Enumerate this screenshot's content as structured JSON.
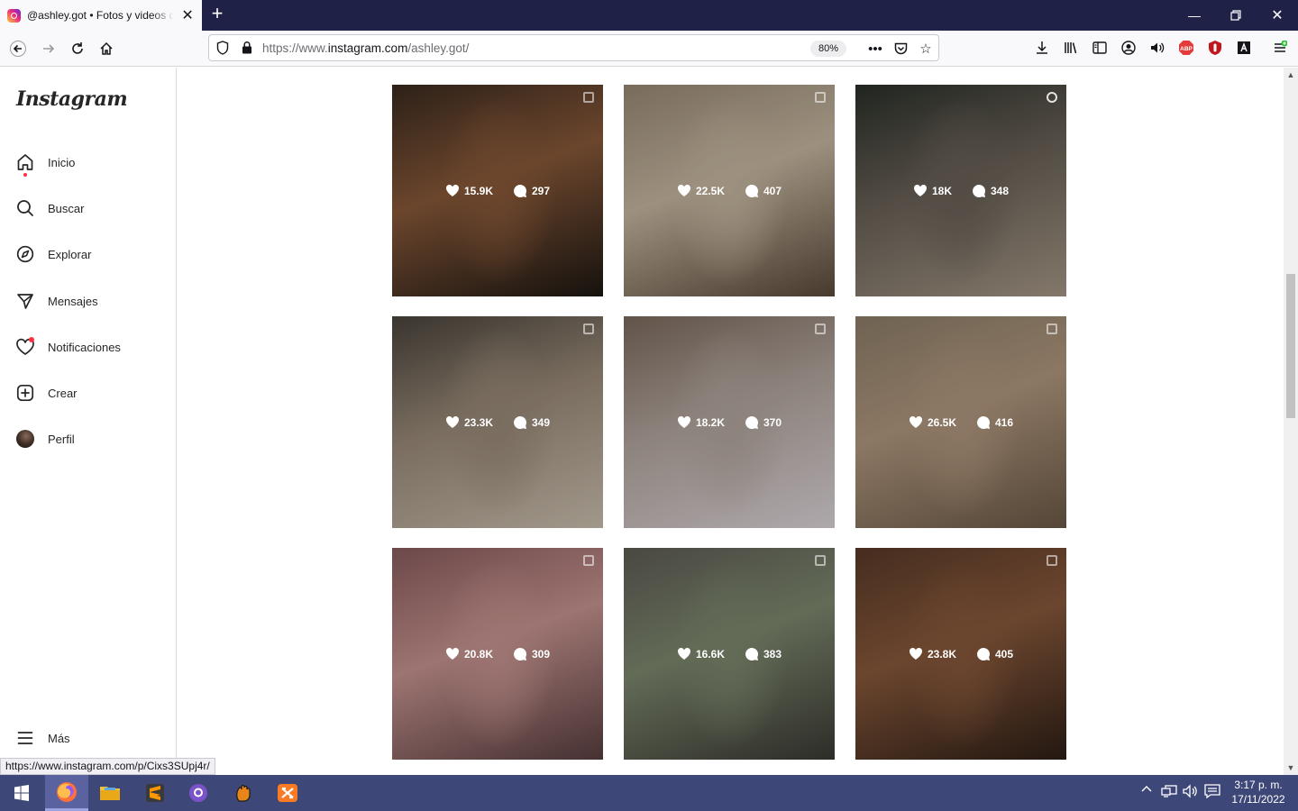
{
  "browser": {
    "tab_title": "@ashley.got • Fotos y videos de Instagram",
    "url_prefix": "https://www.",
    "url_host": "instagram.com",
    "url_path": "/ashley.got/",
    "zoom": "80%",
    "status_link": "https://www.instagram.com/p/Cixs3SUpj4r/"
  },
  "sidebar": {
    "logo": "Instagram",
    "items": [
      {
        "label": "Inicio",
        "icon": "home-icon"
      },
      {
        "label": "Buscar",
        "icon": "search-icon"
      },
      {
        "label": "Explorar",
        "icon": "compass-icon"
      },
      {
        "label": "Mensajes",
        "icon": "send-icon"
      },
      {
        "label": "Notificaciones",
        "icon": "heart-icon"
      },
      {
        "label": "Crear",
        "icon": "plus-square-icon"
      },
      {
        "label": "Perfil",
        "icon": "avatar"
      }
    ],
    "more": "Más"
  },
  "posts": [
    {
      "likes": "15.9K",
      "comments": "297",
      "type": "carousel",
      "colors": [
        "#3a2a1f",
        "#8a5a3a",
        "#1c1712"
      ]
    },
    {
      "likes": "22.5K",
      "comments": "407",
      "type": "carousel",
      "colors": [
        "#9a8a76",
        "#c9b9a3",
        "#5c4b3b"
      ]
    },
    {
      "likes": "18K",
      "comments": "348",
      "type": "reel",
      "colors": [
        "#2a3029",
        "#6a6258",
        "#a89a88"
      ]
    },
    {
      "likes": "23.3K",
      "comments": "349",
      "type": "carousel",
      "colors": [
        "#4a443c",
        "#9c8c7a",
        "#cfc3b2"
      ]
    },
    {
      "likes": "18.2K",
      "comments": "370",
      "type": "carousel",
      "colors": [
        "#7d6b5d",
        "#b5a8a0",
        "#e0d8dc"
      ]
    },
    {
      "likes": "26.5K",
      "comments": "416",
      "type": "carousel",
      "colors": [
        "#8f7f6a",
        "#b39a80",
        "#6d5a47"
      ]
    },
    {
      "likes": "20.8K",
      "comments": "309",
      "type": "carousel",
      "colors": [
        "#8c5d5e",
        "#c99692",
        "#5a3f40"
      ]
    },
    {
      "likes": "16.6K",
      "comments": "383",
      "type": "carousel",
      "colors": [
        "#5f5d55",
        "#7f8a70",
        "#3b3a34"
      ]
    },
    {
      "likes": "23.8K",
      "comments": "405",
      "type": "carousel",
      "colors": [
        "#5a3a28",
        "#8a5a3c",
        "#2e1f16"
      ]
    }
  ],
  "taskbar": {
    "time": "3:17 p. m.",
    "date": "17/11/2022"
  },
  "colors": {
    "tabstrip": "#1f2147",
    "taskbar": "#3e4878",
    "notification": "#ff3040"
  }
}
